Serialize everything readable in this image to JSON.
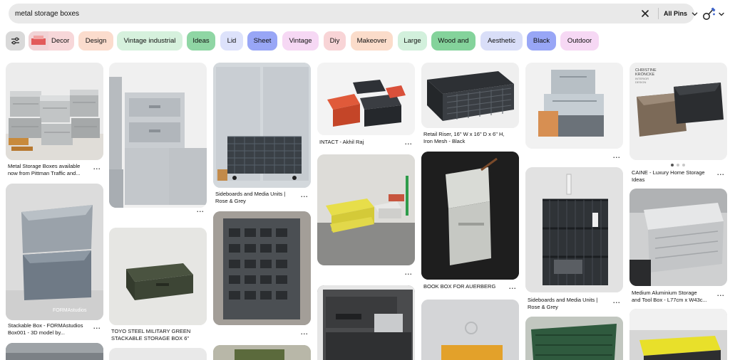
{
  "search": {
    "query": "metal storage boxes",
    "scope_label": "All Pins"
  },
  "icons": {
    "clear": "close-icon",
    "scope": "chevron-down-icon",
    "tool": "image-search-icon",
    "filters": "sliders-icon",
    "more": "more-options-icon"
  },
  "chips": [
    {
      "label": "Decor",
      "color": "#f7d7d9",
      "thumbnail": true
    },
    {
      "label": "Design",
      "color": "#fbdccd"
    },
    {
      "label": "Vintage industrial",
      "color": "#d6f1dd"
    },
    {
      "label": "Ideas",
      "color": "#8fd6a4"
    },
    {
      "label": "Lid",
      "color": "#dde2fb"
    },
    {
      "label": "Sheet",
      "color": "#98a6f6"
    },
    {
      "label": "Vintage",
      "color": "#f6d8f4"
    },
    {
      "label": "Diy",
      "color": "#f8d4d6"
    },
    {
      "label": "Makeover",
      "color": "#fbdcca"
    },
    {
      "label": "Large",
      "color": "#d2f0dc"
    },
    {
      "label": "Wood and",
      "color": "#84d39b"
    },
    {
      "label": "Aesthetic",
      "color": "#d9def8"
    },
    {
      "label": "Black",
      "color": "#98a6f6"
    },
    {
      "label": "Outdoor",
      "color": "#f6d8f4"
    }
  ],
  "pins": [
    {
      "caption": [
        "Metal Storage Boxes available",
        "now from Pittman Traffic and..."
      ]
    },
    {
      "caption": [
        "Stackable Box - FORMAstudios",
        "Box001 - 3D model by..."
      ],
      "image_text": "FORMAstudios"
    },
    {
      "caption": []
    },
    {
      "caption": [
        "TOYO STEEL MILITARY GREEN",
        "STACKABLE STORAGE BOX 6\""
      ]
    },
    {
      "caption": [
        "Sideboards and Media Units |",
        "Rose & Grey"
      ]
    },
    {
      "caption": []
    },
    {
      "caption": [
        "INTACT - Akhil Raj"
      ]
    },
    {
      "caption": []
    },
    {
      "caption": [
        "Retail Riser, 16\" W x 16\" D x 6\" H,",
        "Iron Mesh - Black"
      ]
    },
    {
      "caption": [
        "BOOK BOX FOR AUERBERG"
      ]
    },
    {
      "caption": []
    },
    {
      "caption": [
        "Sideboards and Media Units |",
        "Rose & Grey"
      ]
    },
    {
      "caption": [
        "CAINE - Luxury Home Storage",
        "Ideas"
      ],
      "image_text": [
        "CHRISTINE",
        "KRÖNCKE",
        "INTERIOR",
        "DESIGN"
      ]
    },
    {
      "caption": [
        "Medium Aluminium Storage",
        "and Tool Box - L77cm x W43c..."
      ]
    }
  ],
  "more_label": "..."
}
